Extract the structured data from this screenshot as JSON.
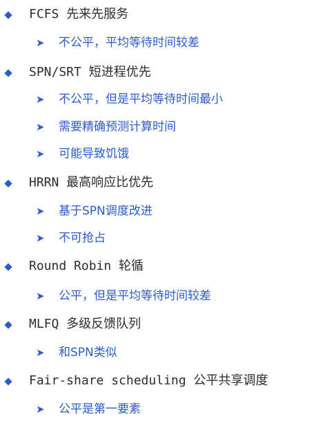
{
  "items": [
    {
      "level": 1,
      "text": "FCFS 先来先服务"
    },
    {
      "level": 2,
      "text": "不公平，平均等待时间较差"
    },
    {
      "level": 1,
      "text": "SPN/SRT 短进程优先"
    },
    {
      "level": 2,
      "text": "不公平，但是平均等待时间最小"
    },
    {
      "level": 2,
      "text": "需要精确预测计算时间"
    },
    {
      "level": 2,
      "text": "可能导致饥饿"
    },
    {
      "level": 1,
      "text": "HRRN 最高响应比优先"
    },
    {
      "level": 2,
      "text": "基于SPN调度改进"
    },
    {
      "level": 2,
      "text": "不可抢占"
    },
    {
      "level": 1,
      "text": "Round Robin 轮循"
    },
    {
      "level": 2,
      "text": "公平，但是平均等待时间较差"
    },
    {
      "level": 1,
      "text": "MLFQ 多级反馈队列"
    },
    {
      "level": 2,
      "text": "和SPN类似"
    },
    {
      "level": 1,
      "text": "Fair-share scheduling 公平共享调度"
    },
    {
      "level": 2,
      "text": "公平是第一要素"
    }
  ],
  "icons": {
    "level1_bullet": "diamond-bullet-icon",
    "level2_bullet": "arrow-bullet-icon"
  },
  "colors": {
    "accent": "#2a5bd0",
    "heading_text": "#2c2c2c",
    "background": "#ffffff"
  }
}
